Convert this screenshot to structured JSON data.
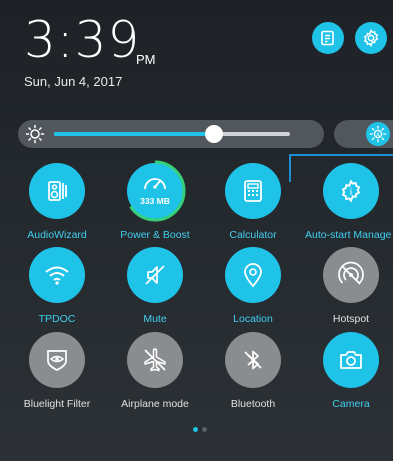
{
  "status": {
    "time": "3:39",
    "ampm": "PM",
    "date": "Sun, Jun 4, 2017"
  },
  "colors": {
    "accent": "#1fc3e8",
    "inactive": "#8a8d90",
    "label_active": "#3fd0f0",
    "label_inactive": "#e0e0e0",
    "callout": "#1a8fd4"
  },
  "brightness": {
    "level": 0.68
  },
  "tiles": [
    {
      "label": "AudioWizard",
      "icon": "audiowizard-icon",
      "active": true
    },
    {
      "label": "Power & Boost",
      "icon": "gauge-icon",
      "active": true,
      "value": "333 MB"
    },
    {
      "label": "Calculator",
      "icon": "calculator-icon",
      "active": true
    },
    {
      "label": "Auto-start Manage",
      "icon": "gear-icon",
      "active": true
    },
    {
      "label": "TPDOC",
      "icon": "wifi-icon",
      "active": true
    },
    {
      "label": "Mute",
      "icon": "mute-icon",
      "active": true
    },
    {
      "label": "Location",
      "icon": "location-pin-icon",
      "active": true
    },
    {
      "label": "Hotspot",
      "icon": "hotspot-icon",
      "active": false
    },
    {
      "label": "Bluelight Filter",
      "icon": "eye-shield-icon",
      "active": false
    },
    {
      "label": "Airplane mode",
      "icon": "airplane-icon",
      "active": false
    },
    {
      "label": "Bluetooth",
      "icon": "bluetooth-icon",
      "active": false
    },
    {
      "label": "Camera",
      "icon": "camera-icon",
      "active": true
    }
  ],
  "pager": {
    "current": 1,
    "total": 2
  }
}
